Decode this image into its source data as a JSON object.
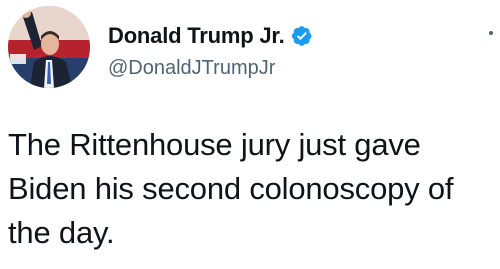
{
  "tweet": {
    "author": {
      "display_name": "Donald Trump Jr.",
      "handle": "@DonaldJTrumpJr",
      "verified_icon": "verified-badge-icon",
      "avatar": "profile-photo"
    },
    "text": "The Rittenhouse jury just gave Biden his second colonoscopy of the day.",
    "more_icon": "more-options-icon"
  },
  "colors": {
    "text_primary": "#0f1419",
    "text_secondary": "#536471",
    "verified_blue": "#1d9bf0"
  }
}
